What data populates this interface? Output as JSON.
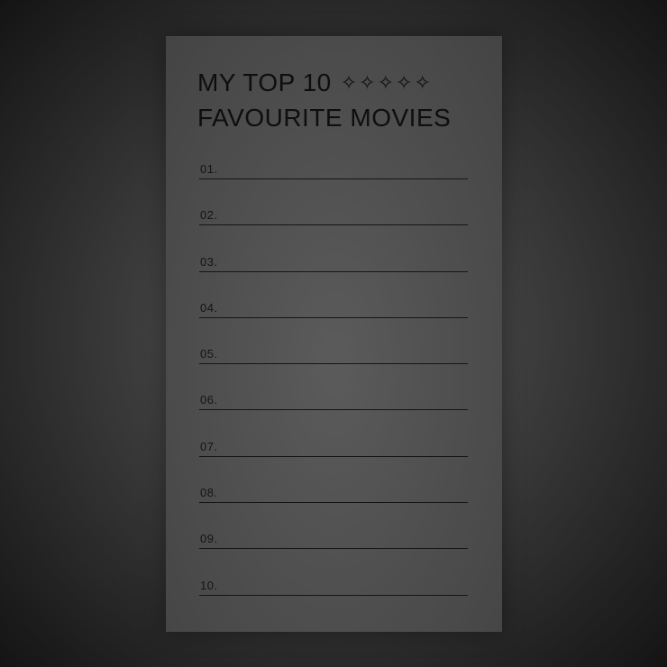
{
  "card": {
    "title_line1": "MY TOP 10",
    "sparkles": "✧✧✧✧✧",
    "title_line2": "FAVOURITE MOVIES"
  },
  "list": {
    "items": [
      {
        "number": "01."
      },
      {
        "number": "02."
      },
      {
        "number": "03."
      },
      {
        "number": "04."
      },
      {
        "number": "05."
      },
      {
        "number": "06."
      },
      {
        "number": "07."
      },
      {
        "number": "08."
      },
      {
        "number": "09."
      },
      {
        "number": "10."
      }
    ]
  },
  "colors": {
    "background_dark": "#141414",
    "card": "#4d4d4d",
    "ink": "#0e0e0e"
  }
}
